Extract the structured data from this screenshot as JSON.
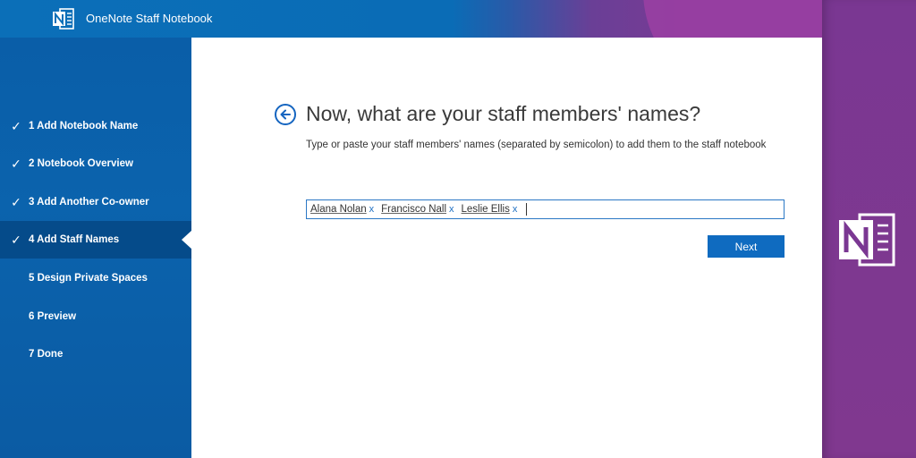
{
  "app": {
    "title": "OneNote Staff Notebook"
  },
  "sidebar": {
    "steps": [
      {
        "label": "1 Add Notebook Name",
        "done": true
      },
      {
        "label": "2 Notebook Overview",
        "done": true
      },
      {
        "label": "3 Add Another Co-owner",
        "done": true
      },
      {
        "label": "4 Add Staff Names",
        "done": true,
        "active": true
      },
      {
        "label": "5 Design Private Spaces",
        "done": false
      },
      {
        "label": "6 Preview",
        "done": false
      },
      {
        "label": "7 Done",
        "done": false
      }
    ],
    "check_glyph": "✓"
  },
  "main": {
    "title": "Now, what are your staff members' names?",
    "subtitle": "Type or paste your staff members' names (separated by semicolon) to add them to the staff notebook",
    "names": [
      "Alana Nolan",
      "Francisco Nall",
      "Leslie Ellis"
    ],
    "remove_glyph": "x",
    "next_label": "Next"
  },
  "colors": {
    "sidebar_blue": "#0a5ea8",
    "active_step": "#054b8a",
    "accent_blue": "#0f6bc0",
    "onenote_purple": "#7a3792"
  }
}
